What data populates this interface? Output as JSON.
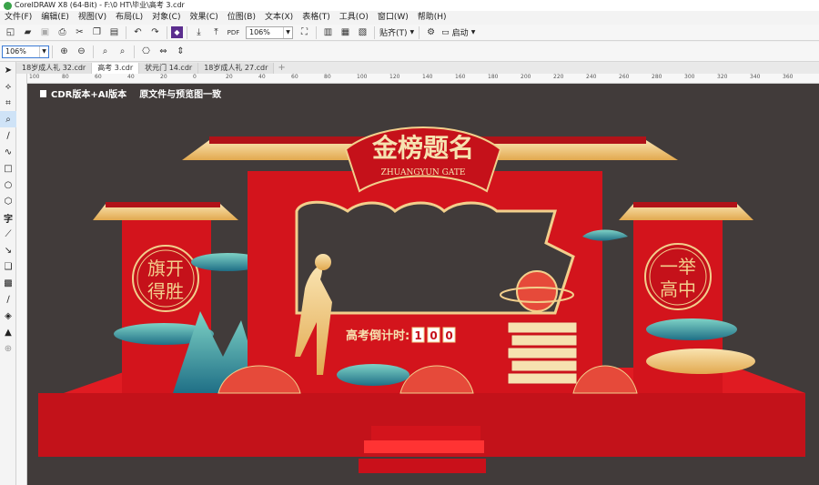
{
  "window": {
    "title": "CorelDRAW X8 (64-Bit) - F:\\0 HT\\毕业\\高考 3.cdr"
  },
  "menu": [
    "文件(F)",
    "编辑(E)",
    "视图(V)",
    "布局(L)",
    "对象(C)",
    "效果(C)",
    "位图(B)",
    "文本(X)",
    "表格(T)",
    "工具(O)",
    "窗口(W)",
    "帮助(H)"
  ],
  "toolbar": {
    "zoom_value": "106%",
    "snap_label": "贴齐(T)",
    "launch_label": "启动"
  },
  "property_bar": {
    "zoom_value": "106%"
  },
  "tabs": [
    {
      "label": "18岁成人礼 32.cdr",
      "active": false
    },
    {
      "label": "高考 3.cdr",
      "active": true
    },
    {
      "label": "状元门 14.cdr",
      "active": false
    },
    {
      "label": "18岁成人礼 27.cdr",
      "active": false
    }
  ],
  "ruler": {
    "labels": [
      "100",
      "80",
      "60",
      "40",
      "20",
      "0",
      "20",
      "40",
      "60",
      "80",
      "100",
      "120",
      "140",
      "160",
      "180",
      "200",
      "220",
      "240",
      "260",
      "280",
      "300",
      "320",
      "340",
      "360"
    ]
  },
  "canvas_note": {
    "part1": "CDR版本+AI版本",
    "part2": "原文件与预览图一致"
  },
  "design": {
    "banner_title": "金榜题名",
    "banner_subtitle": "ZHUANGYUN GATE",
    "left_circle": [
      "旗开",
      "得胜"
    ],
    "right_circle": [
      "一举",
      "高中"
    ],
    "countdown_label": "高考倒计时:",
    "countdown_digits": [
      "1",
      "0",
      "0"
    ]
  },
  "colors": {
    "canvas_bg": "#413b3a",
    "red": "#d3141c",
    "dark_red": "#b11218",
    "gold": "#f2cf8c",
    "teal": "#2f9a98"
  }
}
